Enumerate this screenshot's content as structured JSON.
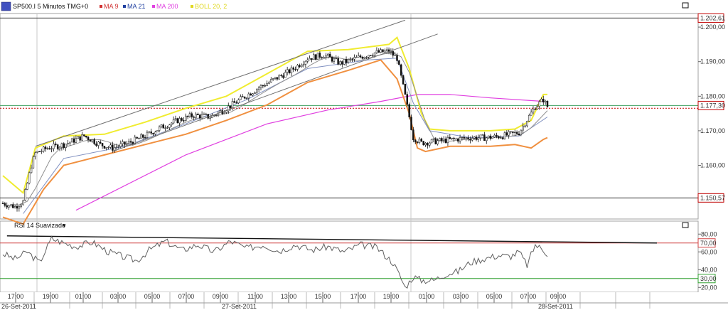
{
  "header": {
    "symbol": "SP500.I 5 Minutos TMG+0",
    "indicators": [
      {
        "label": "MA 9",
        "color": "#d03030"
      },
      {
        "label": "MA 21",
        "color": "#2040a0"
      },
      {
        "label": "MA 200",
        "color": "#e040e0"
      },
      {
        "label": "BOLL 20, 2",
        "color": "#e0d820"
      }
    ]
  },
  "rsi_header": {
    "label": "RSI 14 Suavizado"
  },
  "colors": {
    "ma9": "#d03030",
    "ma21": "#2040a0",
    "ma200": "#e040e0",
    "boll_upper": "#f0ec30",
    "boll_lower": "#f09040",
    "rsi": "#606060",
    "rsi_upper": "#d04040",
    "rsi_lower": "#30a030",
    "price_label": "#c00000"
  },
  "chart_data": [
    {
      "type": "candlestick",
      "title": "SP500.I 5 Minutos TMG+0",
      "ylim": [
        1150,
        1205
      ],
      "y_ticks": [
        "1.200,00",
        "1.190,00",
        "1.180,00",
        "1.170,00",
        "1.160,00"
      ],
      "x_ticks": [
        "17:00",
        "19:00",
        "01:00",
        "03:00",
        "05:00",
        "07:00",
        "09:00",
        "11:00",
        "13:00",
        "15:00",
        "17:00",
        "19:00",
        "01:00",
        "03:00",
        "05:00",
        "07:00",
        "09:00"
      ],
      "date_labels": [
        "26-Set-2011",
        "27-Set-2011",
        "28-Set-2011"
      ],
      "price_labels": [
        {
          "text": "1.202,61",
          "value": 1202.61
        },
        {
          "text": "1.177,30",
          "value": 1177.3
        },
        {
          "text": "1.150,57",
          "value": 1150.57
        }
      ],
      "horizontal_lines": [
        1202.61,
        1177.3,
        1150.57
      ],
      "dotted_line": 1176.5,
      "close_path": [
        [
          0,
          1149
        ],
        [
          3,
          1148
        ],
        [
          5,
          1149.5
        ],
        [
          7,
          1160
        ],
        [
          8,
          1163.5
        ],
        [
          11,
          1165
        ],
        [
          15,
          1166
        ],
        [
          20,
          1168.5
        ],
        [
          24,
          1166
        ],
        [
          27,
          1165
        ],
        [
          31,
          1166.5
        ],
        [
          35,
          1168.5
        ],
        [
          39,
          1171
        ],
        [
          43,
          1173
        ],
        [
          47,
          1174.5
        ],
        [
          51,
          1174
        ],
        [
          55,
          1176.5
        ],
        [
          59,
          1179.5
        ],
        [
          63,
          1182.5
        ],
        [
          67,
          1185
        ],
        [
          71,
          1187.5
        ],
        [
          75,
          1191
        ],
        [
          79,
          1192
        ],
        [
          83,
          1189.5
        ],
        [
          87,
          1191
        ],
        [
          91,
          1192.5
        ],
        [
          95,
          1193
        ],
        [
          97,
          1191
        ],
        [
          99,
          1180
        ],
        [
          101,
          1168
        ],
        [
          103,
          1166.5
        ],
        [
          107,
          1167
        ],
        [
          111,
          1167.5
        ],
        [
          115,
          1168
        ],
        [
          119,
          1168
        ],
        [
          123,
          1168.5
        ],
        [
          127,
          1169.5
        ],
        [
          131,
          1177
        ],
        [
          133,
          1179
        ],
        [
          134,
          1177
        ]
      ],
      "ma200_path": [
        [
          18,
          1147
        ],
        [
          45,
          1163
        ],
        [
          65,
          1172
        ],
        [
          80,
          1176
        ],
        [
          93,
          1178.5
        ],
        [
          102,
          1180.5
        ],
        [
          110,
          1180.5
        ],
        [
          120,
          1179.5
        ],
        [
          133,
          1178.5
        ]
      ],
      "boll_upper_path": [
        [
          0,
          1157
        ],
        [
          5,
          1152
        ],
        [
          8,
          1165
        ],
        [
          15,
          1168.5
        ],
        [
          25,
          1169
        ],
        [
          35,
          1172.5
        ],
        [
          45,
          1176.5
        ],
        [
          55,
          1180
        ],
        [
          65,
          1186.5
        ],
        [
          75,
          1193
        ],
        [
          85,
          1193.5
        ],
        [
          95,
          1195
        ],
        [
          97,
          1197
        ],
        [
          100,
          1188
        ],
        [
          103,
          1175
        ],
        [
          105,
          1170.5
        ],
        [
          110,
          1170
        ],
        [
          120,
          1170
        ],
        [
          126,
          1170.5
        ],
        [
          130,
          1173
        ],
        [
          133,
          1180.5
        ],
        [
          134,
          1180.5
        ]
      ],
      "boll_lower_path": [
        [
          0,
          1145
        ],
        [
          5,
          1143
        ],
        [
          10,
          1153
        ],
        [
          15,
          1160
        ],
        [
          25,
          1163
        ],
        [
          35,
          1166
        ],
        [
          45,
          1169
        ],
        [
          55,
          1173
        ],
        [
          65,
          1177.5
        ],
        [
          75,
          1184
        ],
        [
          85,
          1187.5
        ],
        [
          93,
          1190.5
        ],
        [
          97,
          1185
        ],
        [
          100,
          1175
        ],
        [
          102,
          1165
        ],
        [
          104,
          1164
        ],
        [
          110,
          1165.5
        ],
        [
          120,
          1165.5
        ],
        [
          126,
          1166
        ],
        [
          130,
          1165
        ],
        [
          133,
          1167.5
        ],
        [
          134,
          1168
        ]
      ],
      "ma21_path": [
        [
          5,
          1146
        ],
        [
          15,
          1162
        ],
        [
          30,
          1165.5
        ],
        [
          45,
          1172
        ],
        [
          60,
          1179
        ],
        [
          75,
          1188
        ],
        [
          90,
          1190.5
        ],
        [
          97,
          1191
        ],
        [
          101,
          1178
        ],
        [
          105,
          1170
        ],
        [
          115,
          1168
        ],
        [
          127,
          1168.5
        ],
        [
          134,
          1174
        ]
      ],
      "channel_lines": [
        {
          "from": [
            8,
            1165.5
          ],
          "to": [
            99,
            1202
          ]
        },
        {
          "from": [
            27,
            1164
          ],
          "to": [
            107,
            1198
          ]
        }
      ]
    },
    {
      "type": "line",
      "title": "RSI 14 Suavizado",
      "ylim": [
        10,
        85
      ],
      "y_ticks": [
        "80,00",
        "60,00",
        "40,00",
        "20,00"
      ],
      "reference_lines": [
        {
          "text": "70,00",
          "value": 70
        },
        {
          "text": "30,00",
          "value": 30
        }
      ],
      "trendline": {
        "from": [
          1,
          78
        ],
        "to": [
          158,
          70
        ]
      },
      "rsi_path": [
        [
          0,
          58
        ],
        [
          3,
          52
        ],
        [
          6,
          60
        ],
        [
          9,
          48
        ],
        [
          12,
          75
        ],
        [
          15,
          70
        ],
        [
          18,
          66
        ],
        [
          22,
          71
        ],
        [
          26,
          60
        ],
        [
          30,
          54
        ],
        [
          33,
          50
        ],
        [
          36,
          62
        ],
        [
          40,
          72
        ],
        [
          44,
          62
        ],
        [
          48,
          68
        ],
        [
          52,
          60
        ],
        [
          56,
          72
        ],
        [
          60,
          64
        ],
        [
          64,
          68
        ],
        [
          68,
          61
        ],
        [
          72,
          68
        ],
        [
          76,
          62
        ],
        [
          80,
          66
        ],
        [
          84,
          60
        ],
        [
          88,
          68
        ],
        [
          92,
          65
        ],
        [
          96,
          48
        ],
        [
          98,
          30
        ],
        [
          99,
          20
        ],
        [
          101,
          32
        ],
        [
          103,
          28
        ],
        [
          106,
          28
        ],
        [
          109,
          35
        ],
        [
          112,
          38
        ],
        [
          115,
          48
        ],
        [
          118,
          52
        ],
        [
          122,
          56
        ],
        [
          125,
          55
        ],
        [
          127,
          60
        ],
        [
          129,
          45
        ],
        [
          131,
          68
        ],
        [
          133,
          62
        ],
        [
          134,
          58
        ]
      ]
    }
  ]
}
